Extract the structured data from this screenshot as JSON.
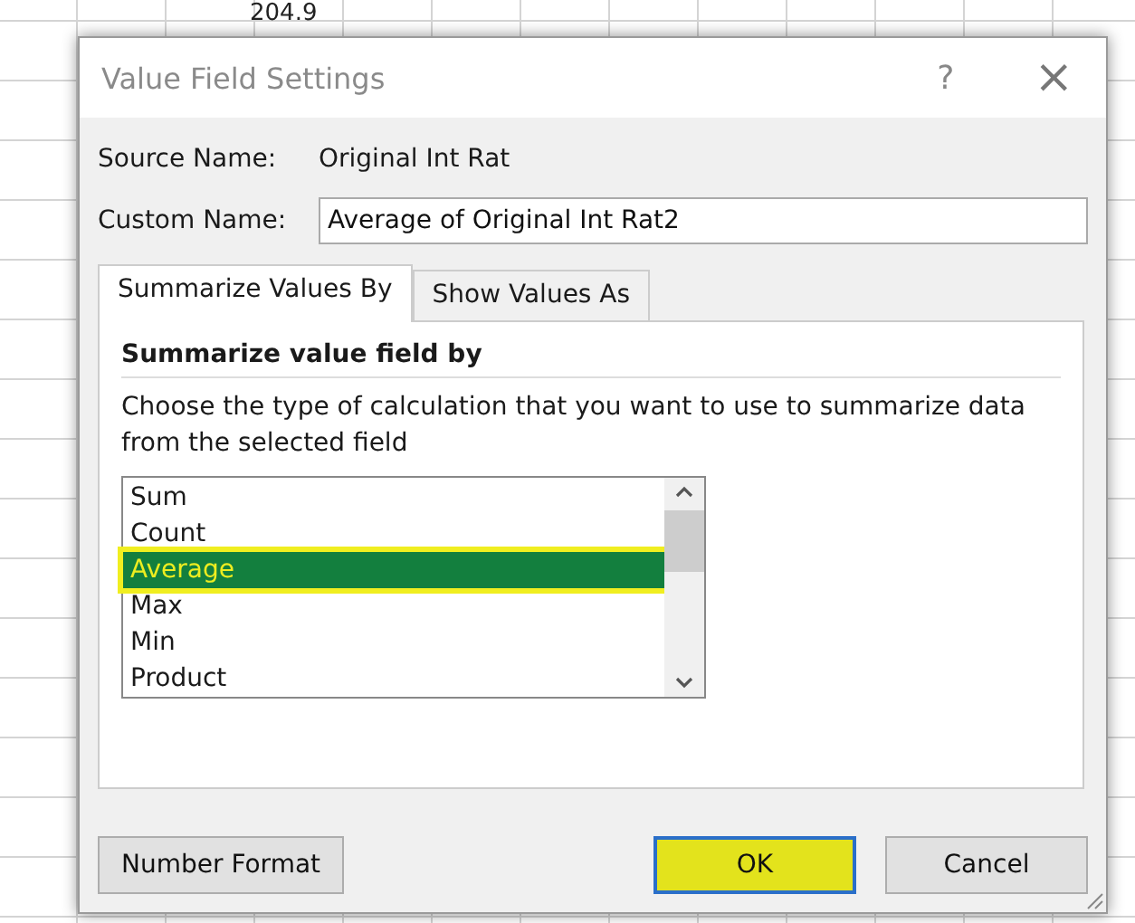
{
  "sheet": {
    "cell_value": "204.9"
  },
  "dialog": {
    "title": "Value Field Settings",
    "help": "?",
    "close": "×",
    "source_label": "Source Name:",
    "source_value": "Original Int Rat",
    "custom_label": "Custom Name:",
    "custom_value": "Average of Original Int Rat2",
    "tabs": [
      {
        "label": "Summarize Values By",
        "selected": true
      },
      {
        "label": "Show Values As",
        "selected": false
      }
    ],
    "section_title": "Summarize value field by",
    "description": "Choose the type of calculation that you want to use to summarize data from the selected field",
    "functions": [
      {
        "label": "Sum",
        "selected": false,
        "highlighted": false
      },
      {
        "label": "Count",
        "selected": false,
        "highlighted": false
      },
      {
        "label": "Average",
        "selected": true,
        "highlighted": true
      },
      {
        "label": "Max",
        "selected": false,
        "highlighted": false
      },
      {
        "label": "Min",
        "selected": false,
        "highlighted": false
      },
      {
        "label": "Product",
        "selected": false,
        "highlighted": false
      }
    ],
    "buttons": [
      {
        "label": "Number Format",
        "kind": "secondary",
        "default": false,
        "highlighted": false
      },
      {
        "label": "OK",
        "kind": "primary",
        "default": true,
        "highlighted": true
      },
      {
        "label": "Cancel",
        "kind": "primary",
        "default": false,
        "highlighted": false
      }
    ]
  }
}
